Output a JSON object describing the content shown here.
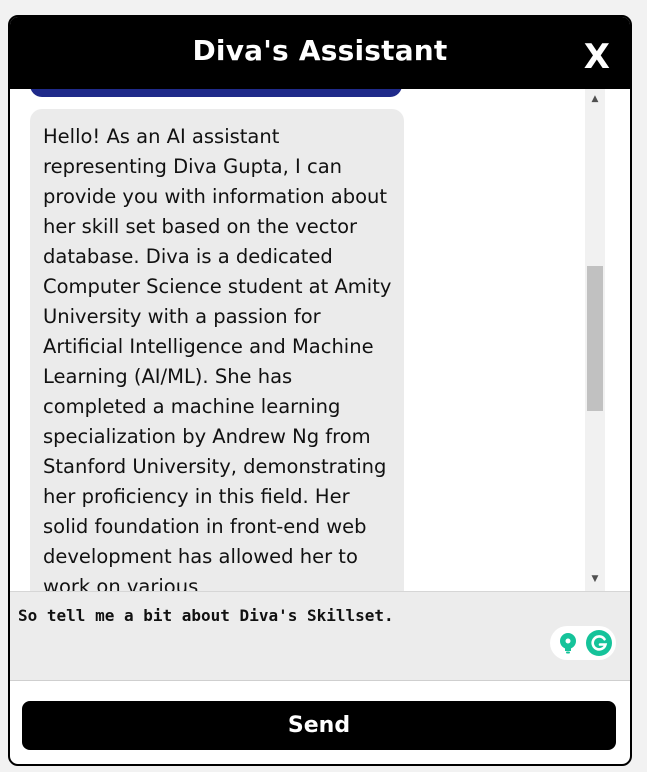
{
  "header": {
    "title": "Diva's Assistant",
    "close_label": "X"
  },
  "chat": {
    "bot_message": "Hello! As an AI assistant representing Diva Gupta, I can provide you with information about her skill set based on the vector database. Diva is a dedicated Computer Science student at Amity University with a passion for Artificial Intelligence and Machine Learning (AI/ML). She has completed a machine learning specialization by Andrew Ng from Stanford University, demonstrating her proficiency in this field. Her solid foundation in front-end web development has allowed her to work on various"
  },
  "scrollbar": {
    "up_arrow": "▲",
    "down_arrow": "▼"
  },
  "input": {
    "value": "So tell me a bit about Diva's Skillset."
  },
  "send": {
    "label": "Send"
  },
  "colors": {
    "header_bg": "#000000",
    "user_bubble": "#1f2a8a",
    "bot_bubble": "#ebebeb",
    "grammarly_green": "#15c39a"
  },
  "icons": {
    "close": "close-icon",
    "grammarly_bulb": "lightbulb-icon",
    "grammarly_logo": "grammarly-icon"
  }
}
